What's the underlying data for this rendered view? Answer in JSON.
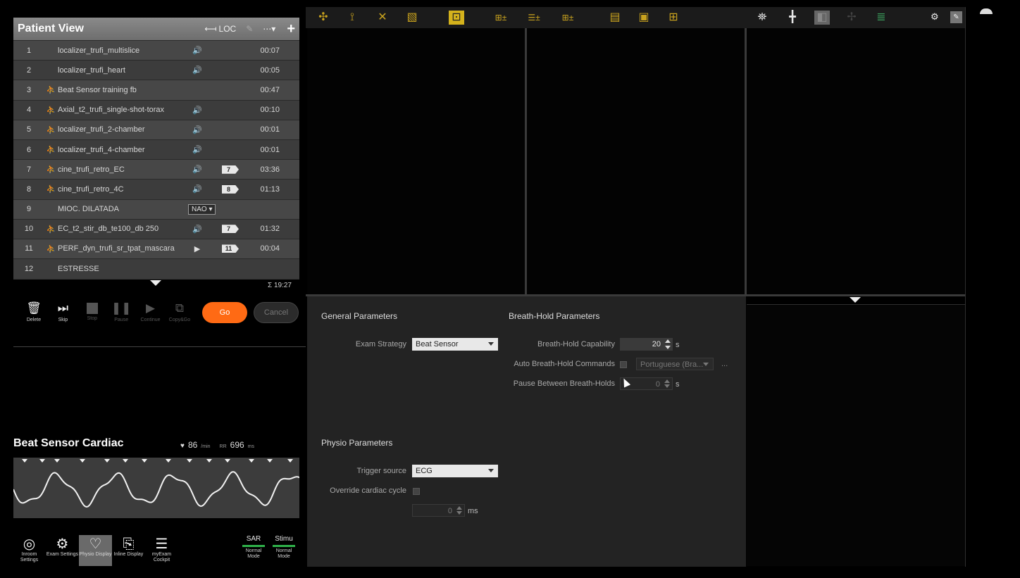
{
  "patient_view": {
    "title": "Patient View",
    "loc_label": "LOC",
    "rows": [
      {
        "num": "1",
        "name": "localizer_trufi_multislice",
        "person": false,
        "sound": true,
        "badge": "",
        "duration": "00:07"
      },
      {
        "num": "2",
        "name": "localizer_trufi_heart",
        "person": false,
        "sound": true,
        "badge": "",
        "duration": "00:05"
      },
      {
        "num": "3",
        "name": "Beat Sensor training fb",
        "person": true,
        "sound": false,
        "badge": "",
        "duration": "00:47"
      },
      {
        "num": "4",
        "name": "Axial_t2_trufi_single-shot-torax",
        "person": true,
        "sound": true,
        "badge": "",
        "duration": "00:10"
      },
      {
        "num": "5",
        "name": "localizer_trufi_2-chamber",
        "person": true,
        "sound": true,
        "badge": "",
        "duration": "00:01"
      },
      {
        "num": "6",
        "name": "localizer_trufi_4-chamber",
        "person": true,
        "sound": true,
        "badge": "",
        "duration": "00:01"
      },
      {
        "num": "7",
        "name": "cine_trufi_retro_EC",
        "person": true,
        "sound": true,
        "badge": "7",
        "duration": "03:36"
      },
      {
        "num": "8",
        "name": "cine_trufi_retro_4C",
        "person": true,
        "sound": true,
        "badge": "8",
        "duration": "01:13"
      },
      {
        "num": "9",
        "name": "MIOC. DILATADA",
        "person": false,
        "sound": false,
        "badge": "",
        "duration": "",
        "select": "NAO"
      },
      {
        "num": "10",
        "name": "EC_t2_stir_db_te100_db 250",
        "person": true,
        "sound": true,
        "badge": "7",
        "duration": "01:32"
      },
      {
        "num": "11",
        "name": "PERF_dyn_trufi_sr_tpat_mascara",
        "person": true,
        "sound": false,
        "play": true,
        "badge": "11",
        "duration": "00:04"
      },
      {
        "num": "12",
        "name": "ESTRESSE",
        "person": false,
        "sound": false,
        "badge": "",
        "duration": ""
      }
    ],
    "total": "Σ 19:27"
  },
  "controls": {
    "delete": "Delete",
    "skip": "Skip",
    "stop": "Stop",
    "pause": "Pause",
    "continue": "Continue",
    "copy_go": "Copy&Go",
    "go": "Go",
    "cancel": "Cancel"
  },
  "beat_sensor": {
    "title": "Beat Sensor Cardiac",
    "hr_value": "86",
    "hr_unit": "/min",
    "rr_label": "RR",
    "rr_value": "696",
    "rr_unit": "ms"
  },
  "bottom_icons": [
    {
      "label": "Inroom Settings"
    },
    {
      "label": "Exam Settings"
    },
    {
      "label": "Physio Display"
    },
    {
      "label": "Inline Display"
    },
    {
      "label": "myExam Cockpit"
    }
  ],
  "modes": {
    "sar_title": "SAR",
    "sar_value": "Normal Mode",
    "stimu_title": "Stimu",
    "stimu_value": "Normal Mode"
  },
  "params": {
    "general_title": "General Parameters",
    "exam_strategy_label": "Exam Strategy",
    "exam_strategy_value": "Beat Sensor",
    "breath_title": "Breath-Hold Parameters",
    "bh_capability_label": "Breath-Hold Capability",
    "bh_capability_value": "20",
    "bh_capability_unit": "s",
    "auto_bh_label": "Auto Breath-Hold Commands",
    "auto_bh_lang": "Portuguese (Bra...",
    "more": "...",
    "pause_label": "Pause Between Breath-Holds",
    "pause_value": "0",
    "pause_unit": "s",
    "physio_title": "Physio Parameters",
    "trigger_label": "Trigger source",
    "trigger_value": "ECG",
    "override_label": "Override cardiac cycle",
    "override_value": "0",
    "override_unit": "ms"
  },
  "colors": {
    "go": "#ff6a14",
    "accent_yellow": "#d4b21c",
    "mode_green": "#2fb24a"
  }
}
